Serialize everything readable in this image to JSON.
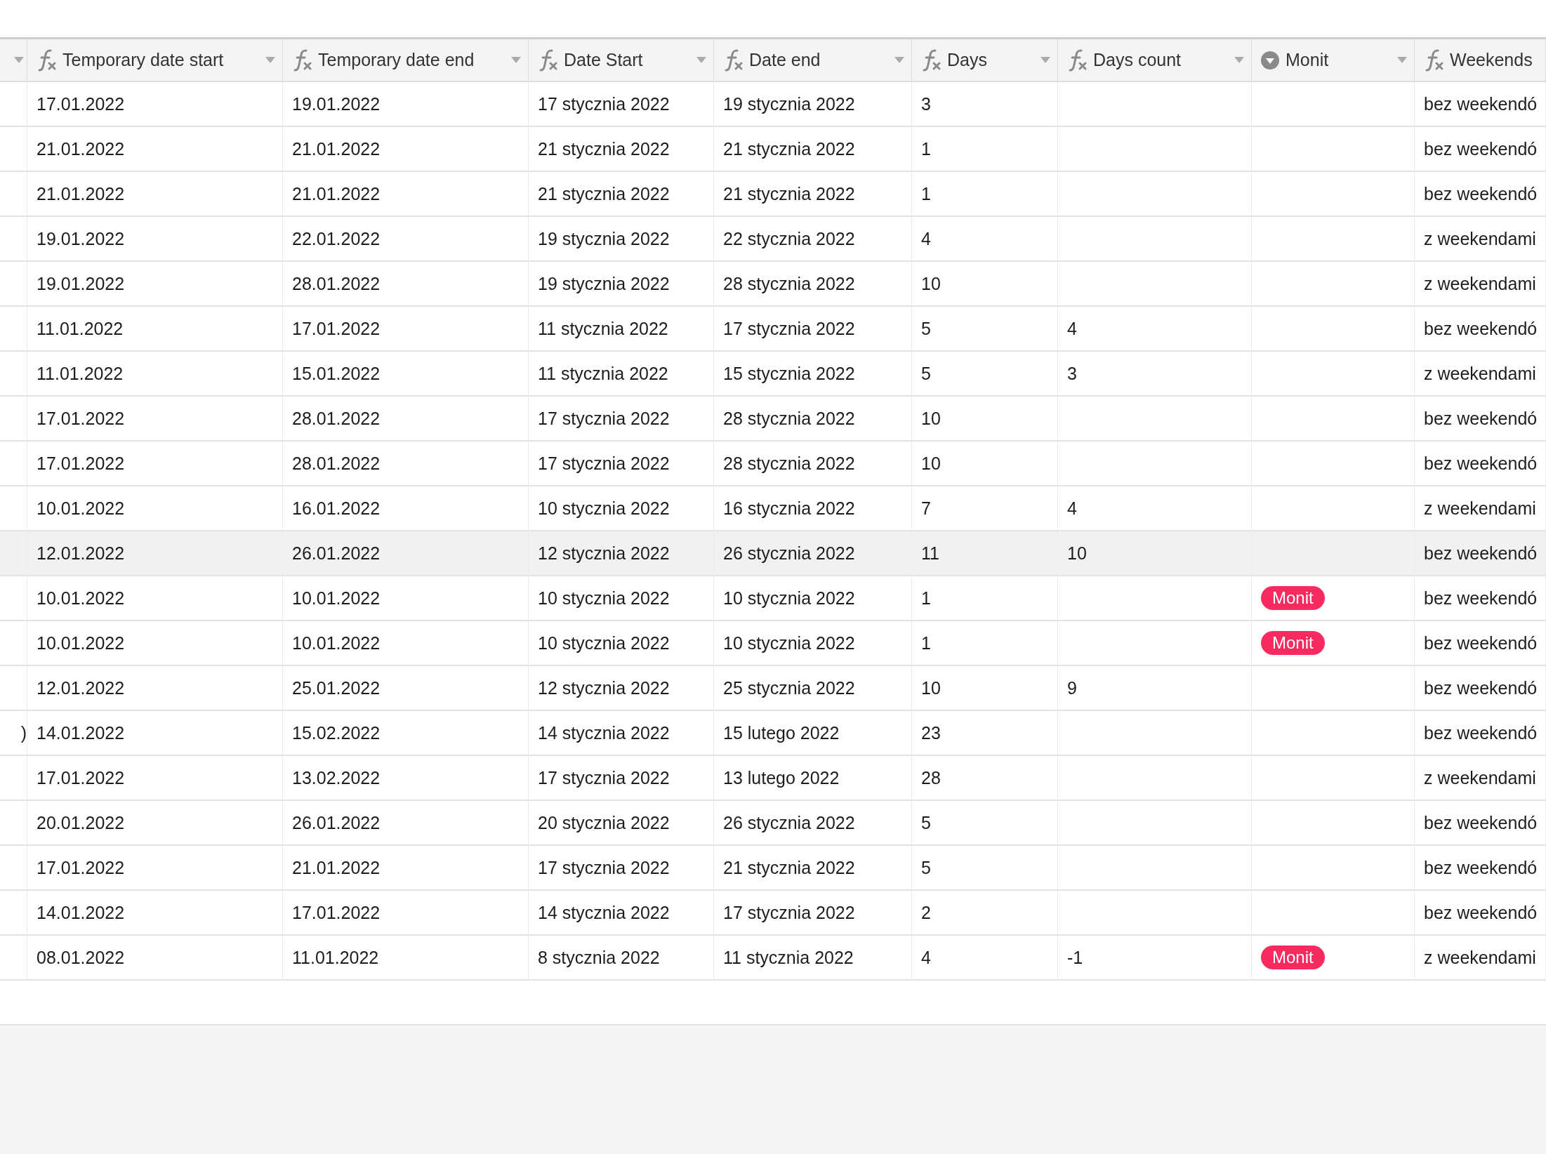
{
  "table": {
    "columns": [
      {
        "kind": "cut"
      },
      {
        "kind": "formula",
        "label": "Temporary date start"
      },
      {
        "kind": "formula",
        "label": "Temporary date end"
      },
      {
        "kind": "formula",
        "label": "Date Start"
      },
      {
        "kind": "formula",
        "label": "Date end"
      },
      {
        "kind": "formula",
        "label": "Days"
      },
      {
        "kind": "formula",
        "label": "Days count"
      },
      {
        "kind": "select",
        "label": "Monit"
      },
      {
        "kind": "formula",
        "label": "Weekends"
      }
    ],
    "rows": [
      {
        "highlighted": false,
        "cells": [
          null,
          "17.01.2022",
          "19.01.2022",
          "17 stycznia 2022",
          "19 stycznia 2022",
          "3",
          null,
          null,
          "bez weekendó"
        ]
      },
      {
        "highlighted": false,
        "cells": [
          null,
          "21.01.2022",
          "21.01.2022",
          "21 stycznia 2022",
          "21 stycznia 2022",
          "1",
          null,
          null,
          "bez weekendó"
        ]
      },
      {
        "highlighted": false,
        "cells": [
          null,
          "21.01.2022",
          "21.01.2022",
          "21 stycznia 2022",
          "21 stycznia 2022",
          "1",
          null,
          null,
          "bez weekendó"
        ]
      },
      {
        "highlighted": false,
        "cells": [
          null,
          "19.01.2022",
          "22.01.2022",
          "19 stycznia 2022",
          "22 stycznia 2022",
          "4",
          null,
          null,
          "z weekendami"
        ]
      },
      {
        "highlighted": false,
        "cells": [
          null,
          "19.01.2022",
          "28.01.2022",
          "19 stycznia 2022",
          "28 stycznia 2022",
          "10",
          null,
          null,
          "z weekendami"
        ]
      },
      {
        "highlighted": false,
        "cells": [
          null,
          "11.01.2022",
          "17.01.2022",
          "11 stycznia 2022",
          "17 stycznia 2022",
          "5",
          "4",
          null,
          "bez weekendó"
        ]
      },
      {
        "highlighted": false,
        "cells": [
          null,
          "11.01.2022",
          "15.01.2022",
          "11 stycznia 2022",
          "15 stycznia 2022",
          "5",
          "3",
          null,
          "z weekendami"
        ]
      },
      {
        "highlighted": false,
        "cells": [
          null,
          "17.01.2022",
          "28.01.2022",
          "17 stycznia 2022",
          "28 stycznia 2022",
          "10",
          null,
          null,
          "bez weekendó"
        ]
      },
      {
        "highlighted": false,
        "cells": [
          null,
          "17.01.2022",
          "28.01.2022",
          "17 stycznia 2022",
          "28 stycznia 2022",
          "10",
          null,
          null,
          "bez weekendó"
        ]
      },
      {
        "highlighted": false,
        "cells": [
          null,
          "10.01.2022",
          "16.01.2022",
          "10 stycznia 2022",
          "16 stycznia 2022",
          "7",
          "4",
          null,
          "z weekendami"
        ]
      },
      {
        "highlighted": true,
        "cells": [
          null,
          "12.01.2022",
          "26.01.2022",
          "12 stycznia 2022",
          "26 stycznia 2022",
          "11",
          "10",
          null,
          "bez weekendó"
        ]
      },
      {
        "highlighted": false,
        "cells": [
          null,
          "10.01.2022",
          "10.01.2022",
          "10 stycznia 2022",
          "10 stycznia 2022",
          "1",
          null,
          {
            "tag": "Monit",
            "color": "#f82b60"
          },
          "bez weekendó"
        ]
      },
      {
        "highlighted": false,
        "cells": [
          null,
          "10.01.2022",
          "10.01.2022",
          "10 stycznia 2022",
          "10 stycznia 2022",
          "1",
          null,
          {
            "tag": "Monit",
            "color": "#f82b60"
          },
          "bez weekendó"
        ]
      },
      {
        "highlighted": false,
        "cells": [
          null,
          "12.01.2022",
          "25.01.2022",
          "12 stycznia 2022",
          "25 stycznia 2022",
          "10",
          "9",
          null,
          "bez weekendó"
        ]
      },
      {
        "highlighted": false,
        "cells": [
          ")",
          "14.01.2022",
          "15.02.2022",
          "14 stycznia 2022",
          "15 lutego 2022",
          "23",
          null,
          null,
          "bez weekendó"
        ]
      },
      {
        "highlighted": false,
        "cells": [
          null,
          "17.01.2022",
          "13.02.2022",
          "17 stycznia 2022",
          "13 lutego 2022",
          "28",
          null,
          null,
          "z weekendami"
        ]
      },
      {
        "highlighted": false,
        "cells": [
          null,
          "20.01.2022",
          "26.01.2022",
          "20 stycznia 2022",
          "26 stycznia 2022",
          "5",
          null,
          null,
          "bez weekendó"
        ]
      },
      {
        "highlighted": false,
        "cells": [
          null,
          "17.01.2022",
          "21.01.2022",
          "17 stycznia 2022",
          "21 stycznia 2022",
          "5",
          null,
          null,
          "bez weekendó"
        ]
      },
      {
        "highlighted": false,
        "cells": [
          null,
          "14.01.2022",
          "17.01.2022",
          "14 stycznia 2022",
          "17 stycznia 2022",
          "2",
          null,
          null,
          "bez weekendó"
        ]
      },
      {
        "highlighted": false,
        "cells": [
          null,
          "08.01.2022",
          "11.01.2022",
          "8 stycznia 2022",
          "11 stycznia 2022",
          "4",
          "-1",
          {
            "tag": "Monit",
            "color": "#f82b60"
          },
          "z weekendami"
        ]
      }
    ]
  }
}
